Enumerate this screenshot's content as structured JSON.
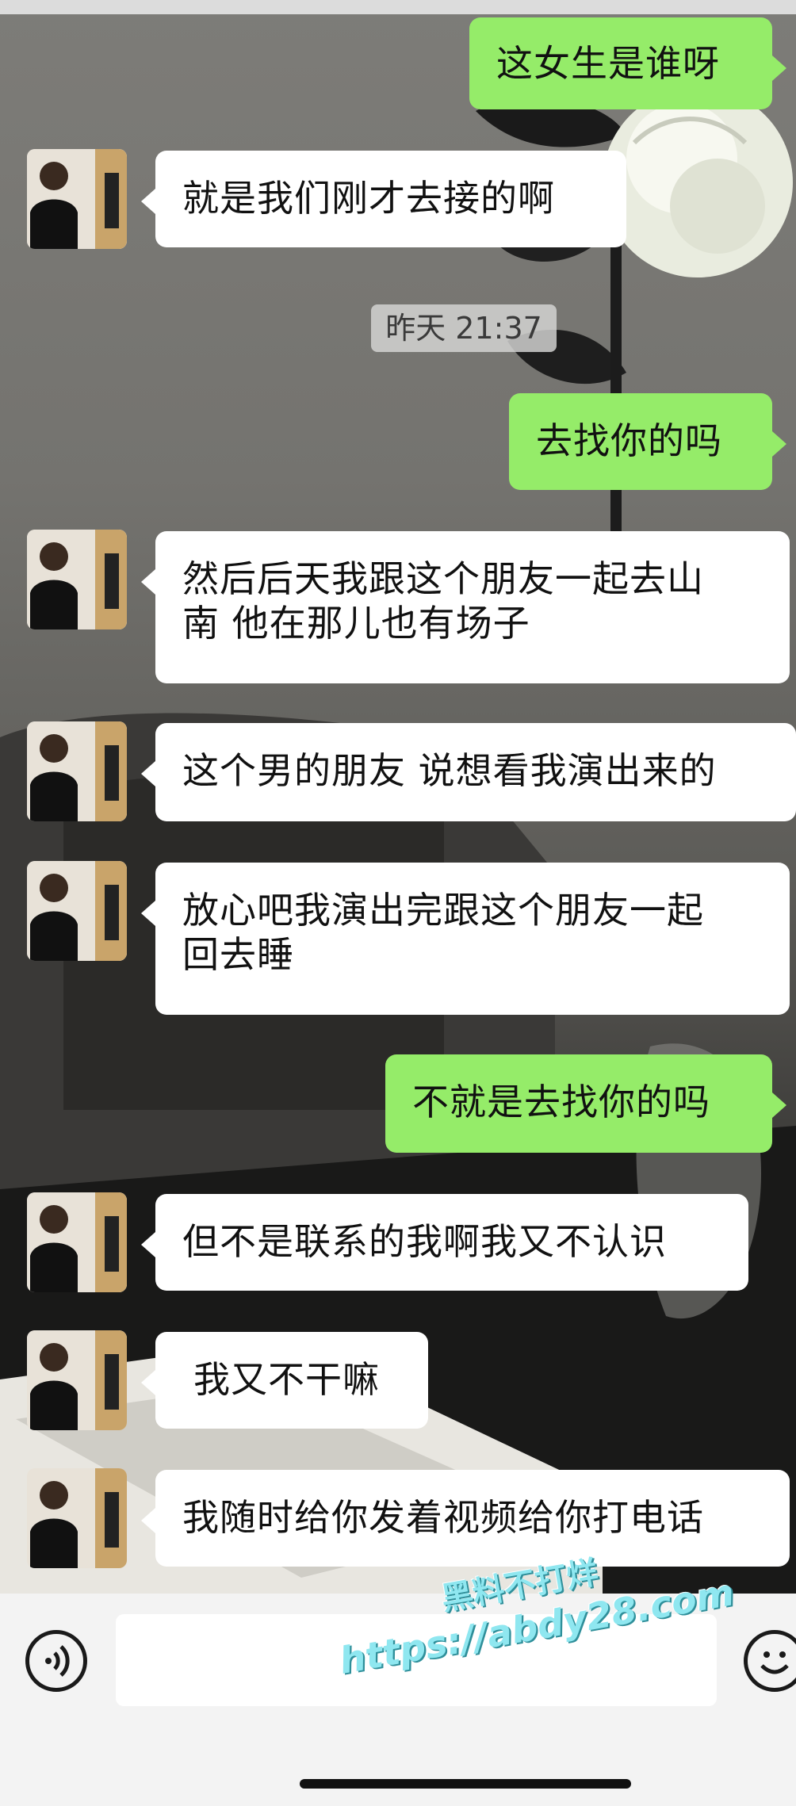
{
  "timestamp": "昨天 21:37",
  "messages": [
    {
      "from": "me",
      "text": "这女生是谁呀"
    },
    {
      "from": "contact",
      "text": "就是我们刚才去接的啊"
    },
    {
      "from": "me",
      "text": "去找你的吗"
    },
    {
      "from": "contact",
      "lines": [
        "然后后天我跟这个朋友一起去山",
        "南 他在那儿也有场子"
      ]
    },
    {
      "from": "contact",
      "text": "这个男的朋友 说想看我演出来的"
    },
    {
      "from": "contact",
      "lines": [
        "放心吧我演出完跟这个朋友一起",
        "回去睡"
      ]
    },
    {
      "from": "me",
      "text": "不就是去找你的吗"
    },
    {
      "from": "contact",
      "text": "但不是联系的我啊我又不认识"
    },
    {
      "from": "contact",
      "text": "我又不干嘛"
    },
    {
      "from": "contact",
      "text": "我随时给你发着视频给你打电话"
    }
  ],
  "input_bar": {
    "voice_icon": "voice-icon",
    "emoji_icon": "emoji-icon",
    "text_value": ""
  },
  "watermark": {
    "line1": "黑料不打烊",
    "line2": "https://abdy28.com"
  },
  "colors": {
    "outgoing_bubble": "#95ec69",
    "incoming_bubble": "#ffffff",
    "input_bar_bg": "#f3f3f3"
  }
}
